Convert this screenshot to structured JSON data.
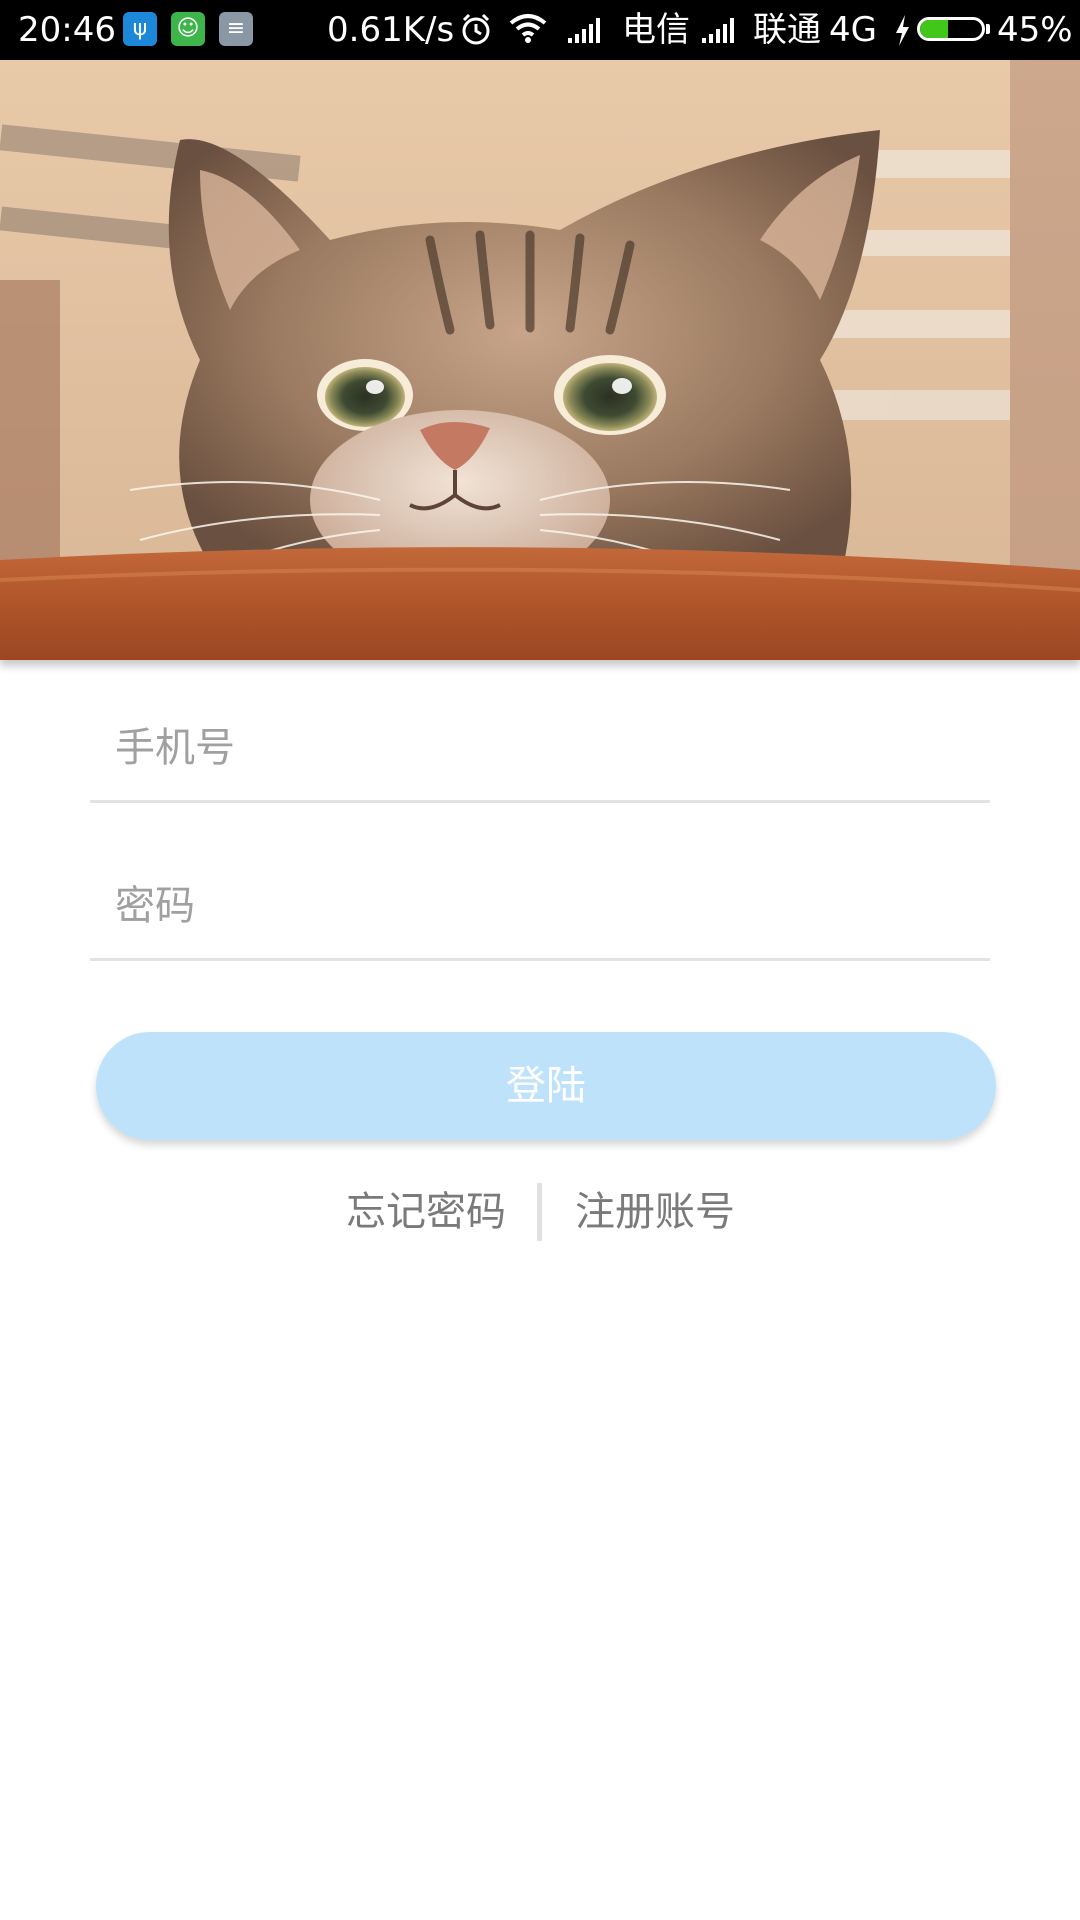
{
  "status_bar": {
    "time": "20:46",
    "net_speed": "0.61K/s",
    "carrier_1": "电信",
    "carrier_2": "联通",
    "network_type": "4G",
    "battery_percent": "45%",
    "battery_level": 0.45,
    "icons": [
      "usb-icon",
      "android-icon",
      "notes-icon",
      "alarm-icon",
      "wifi-icon",
      "signal-icon",
      "charging-icon",
      "battery-icon"
    ]
  },
  "header_image": {
    "subject": "cat-photo"
  },
  "form": {
    "phone_placeholder": "手机号",
    "password_placeholder": "密码",
    "login_label": "登陆"
  },
  "links": {
    "forgot_password": "忘记密码",
    "register": "注册账号"
  },
  "colors": {
    "login_button": "#bfe2fb",
    "status_bar": "#000000",
    "battery_fill": "#41c71a",
    "placeholder_text": "#a0a0a0",
    "link_text": "#7a7a7a",
    "divider": "#e3e3e3"
  }
}
